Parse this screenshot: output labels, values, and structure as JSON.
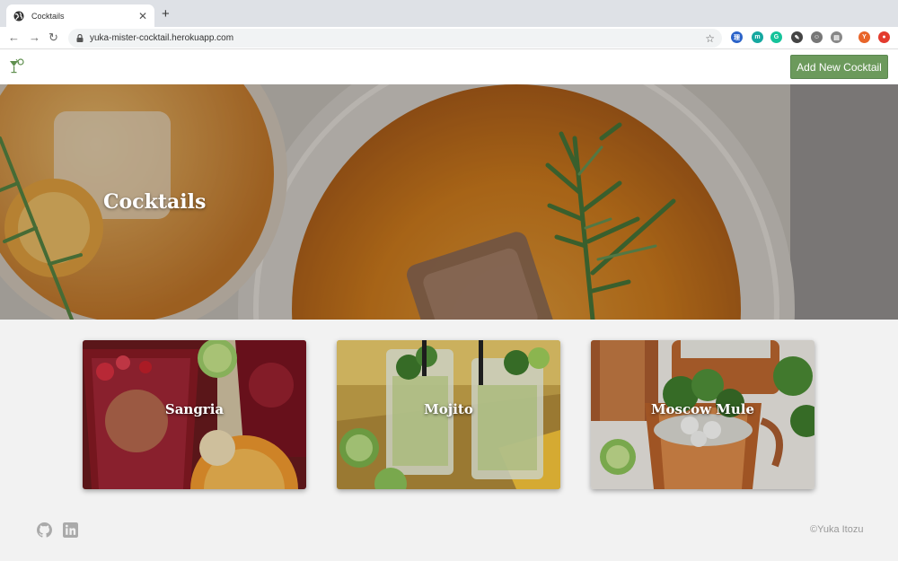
{
  "browser": {
    "tab_title": "Cocktails",
    "tab_close": "✕",
    "new_tab": "+",
    "url": "yuka-mister-cocktail.herokuapp.com",
    "back": "←",
    "forward": "→",
    "reload": "↻",
    "star": "☆",
    "extensions": [
      {
        "name": "ext-translate-icon",
        "label": "理",
        "color": "#2b63c9"
      },
      {
        "name": "ext-m-icon",
        "label": "m",
        "color": "#15a8a0"
      },
      {
        "name": "ext-grammarly-icon",
        "label": "G",
        "color": "#15c39a"
      },
      {
        "name": "ext-dropper-icon",
        "label": "✎",
        "color": "#444444"
      },
      {
        "name": "ext-face-icon",
        "label": "☺",
        "color": "#777777"
      },
      {
        "name": "ext-layers-icon",
        "label": "▤",
        "color": "#888888"
      },
      {
        "name": "profile-avatar",
        "label": "Y",
        "color": "#e8652a"
      },
      {
        "name": "ext-red-icon",
        "label": "●",
        "color": "#e33b2e"
      }
    ]
  },
  "header": {
    "add_button": "Add New Cocktail",
    "accent": "#6c9a5c"
  },
  "hero": {
    "title": "Cocktails"
  },
  "cards": [
    {
      "name": "Sangria"
    },
    {
      "name": "Mojito"
    },
    {
      "name": "Moscow Mule"
    }
  ],
  "footer": {
    "copyright": "©Yuka Itozu",
    "icons": [
      "github-icon",
      "linkedin-icon"
    ]
  }
}
